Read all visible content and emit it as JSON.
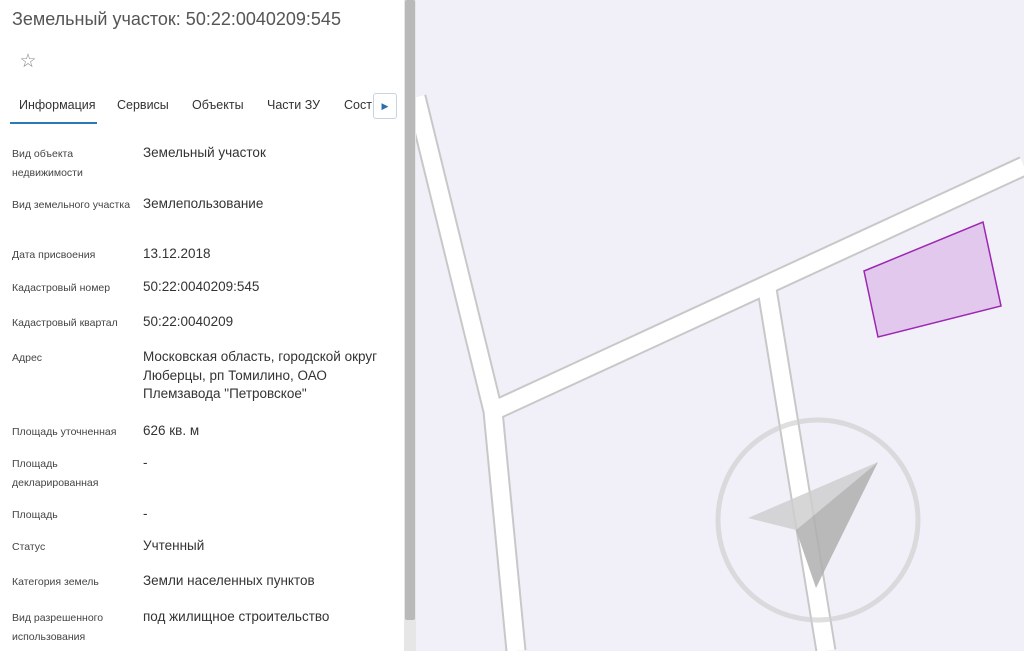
{
  "header": {
    "title": "Земельный участок: 50:22:0040209:545",
    "favorite_icon": "star-outline-icon"
  },
  "tabs": [
    {
      "label": "Информация",
      "active": true
    },
    {
      "label": "Сервисы",
      "active": false
    },
    {
      "label": "Объекты",
      "active": false
    },
    {
      "label": "Части ЗУ",
      "active": false
    },
    {
      "label": "Соста",
      "active": false
    }
  ],
  "tabs_overflow_glyph": "▶",
  "accent_color": "#2a7ab8",
  "parcel_color": "#9c27b0",
  "info": {
    "object_type_label": "Вид объекта недвижимости",
    "object_type_value": "Земельный участок",
    "land_type_label": "Вид земельного участка",
    "land_type_value": "Землепользование",
    "assign_date_label": "Дата присвоения",
    "assign_date_value": "13.12.2018",
    "cadastral_number_label": "Кадастровый номер",
    "cadastral_number_value": "50:22:0040209:545",
    "cadastral_quarter_label": "Кадастровый квартал",
    "cadastral_quarter_value": "50:22:0040209",
    "address_label": "Адрес",
    "address_value": "Московская область, городской округ Люберцы, рп Томилино, ОАО Племзавода \"Петровское\"",
    "area_refined_label": "Площадь уточненная",
    "area_refined_value": "626 кв. м",
    "area_declared_label": "Площадь декларированная",
    "area_declared_value": "-",
    "area_label": "Площадь",
    "area_value": "-",
    "status_label": "Статус",
    "status_value": "Учтенный",
    "land_category_label": "Категория земель",
    "land_category_value": "Земли населенных пунктов",
    "permitted_use_label": "Вид разрешенного использования",
    "permitted_use_value": "под жилищное строительство"
  }
}
